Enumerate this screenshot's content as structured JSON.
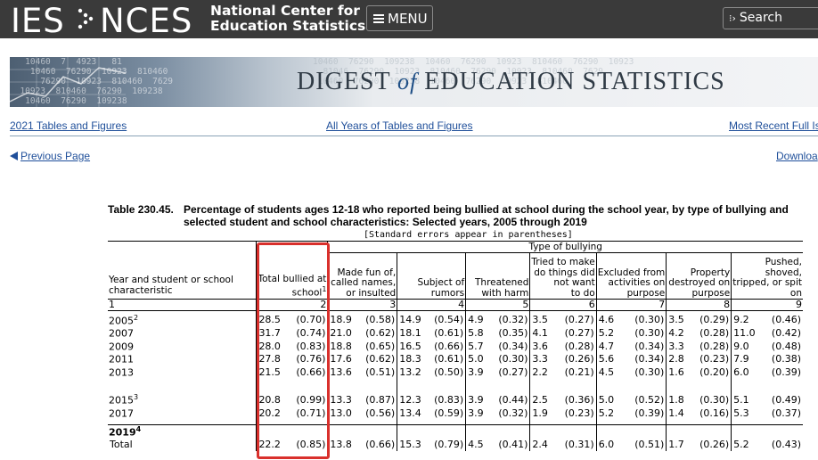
{
  "header": {
    "logo_ies": "IES",
    "logo_nces": "NCES",
    "org_line1": "National Center for",
    "org_line2": "Education Statistics",
    "menu_label": "MENU",
    "search_label": "Search"
  },
  "banner": {
    "title_part1": "DIGEST",
    "title_of": "of",
    "title_part2": "EDUCATION STATISTICS",
    "numbers_left": "   10460  7  4923   81\n    10460  76290  10923  810460\n      76290  10923  810460  7629\n  10923  810460  76290  109238\n   10460  76290  109238",
    "numbers_right": "10460  76290  109238  10460  76290  10923  810460  76290  10923\n  81046  76290  10923  810460  76290  10923  810460  7629\n 10460  76290  109238  10460  76290  10923  810460"
  },
  "nav": {
    "link_2021": "2021 Tables and Figures",
    "link_all_years": "All Years of Tables and Figures",
    "link_recent": "Most Recent Full Is",
    "previous_page": "Previous Page",
    "download": "Downloa"
  },
  "table": {
    "number": "Table 230.45.",
    "title": "Percentage of students ages 12-18 who reported being bullied at school during the school year, by type of bullying and selected student and school characteristics: Selected years, 2005 through 2019",
    "se_note": "[Standard errors appear in parentheses]",
    "type_header": "Type of bullying",
    "col0_line1": "Year and student or school",
    "col0_line2": "characteristic",
    "col1_line1": "Total bullied at",
    "col1_line2": "school",
    "col1_sup": "1",
    "col2_line1": "Made fun of,",
    "col2_line2": "called names,",
    "col2_line3": "or insulted",
    "col3_line1": "Subject of",
    "col3_line2": "rumors",
    "col4_line1": "Threatened",
    "col4_line2": "with harm",
    "col5_line1": "Tried to make",
    "col5_line2": "do things did",
    "col5_line3": "not want",
    "col5_line4": "to do",
    "col6_line1": "Excluded from",
    "col6_line2": "activities on",
    "col6_line3": "purpose",
    "col7_line1": "Property",
    "col7_line2": "destroyed on",
    "col7_line3": "purpose",
    "col8_line1": "Pushed,",
    "col8_line2": "shoved,",
    "col8_line3": "tripped, or spit",
    "col8_line4": "on",
    "colnums": [
      "1",
      "2",
      "3",
      "4",
      "5",
      "6",
      "7",
      "8",
      "9"
    ],
    "rows": [
      {
        "year": "2005",
        "sup": "2",
        "vals": [
          "28.5",
          "(0.70)",
          "18.9",
          "(0.58)",
          "14.9",
          "(0.54)",
          "4.9",
          "(0.32)",
          "3.5",
          "(0.27)",
          "4.6",
          "(0.30)",
          "3.5",
          "(0.29)",
          "9.2",
          "(0.46)"
        ]
      },
      {
        "year": "2007",
        "sup": "",
        "vals": [
          "31.7",
          "(0.74)",
          "21.0",
          "(0.62)",
          "18.1",
          "(0.61)",
          "5.8",
          "(0.35)",
          "4.1",
          "(0.27)",
          "5.2",
          "(0.30)",
          "4.2",
          "(0.28)",
          "11.0",
          "(0.42)"
        ]
      },
      {
        "year": "2009",
        "sup": "",
        "vals": [
          "28.0",
          "(0.83)",
          "18.8",
          "(0.65)",
          "16.5",
          "(0.66)",
          "5.7",
          "(0.34)",
          "3.6",
          "(0.28)",
          "4.7",
          "(0.34)",
          "3.3",
          "(0.28)",
          "9.0",
          "(0.48)"
        ]
      },
      {
        "year": "2011",
        "sup": "",
        "vals": [
          "27.8",
          "(0.76)",
          "17.6",
          "(0.62)",
          "18.3",
          "(0.61)",
          "5.0",
          "(0.30)",
          "3.3",
          "(0.26)",
          "5.6",
          "(0.34)",
          "2.8",
          "(0.23)",
          "7.9",
          "(0.38)"
        ]
      },
      {
        "year": "2013",
        "sup": "",
        "vals": [
          "21.5",
          "(0.66)",
          "13.6",
          "(0.51)",
          "13.2",
          "(0.50)",
          "3.9",
          "(0.27)",
          "2.2",
          "(0.21)",
          "4.5",
          "(0.30)",
          "1.6",
          "(0.20)",
          "6.0",
          "(0.39)"
        ]
      },
      {
        "year": "2015",
        "sup": "3",
        "vals": [
          "20.8",
          "(0.99)",
          "13.3",
          "(0.87)",
          "12.3",
          "(0.83)",
          "3.9",
          "(0.44)",
          "2.5",
          "(0.36)",
          "5.0",
          "(0.52)",
          "1.8",
          "(0.30)",
          "5.1",
          "(0.49)"
        ]
      },
      {
        "year": "2017",
        "sup": "",
        "vals": [
          "20.2",
          "(0.71)",
          "13.0",
          "(0.56)",
          "13.4",
          "(0.59)",
          "3.9",
          "(0.32)",
          "1.9",
          "(0.23)",
          "5.2",
          "(0.39)",
          "1.4",
          "(0.16)",
          "5.3",
          "(0.37)"
        ]
      }
    ],
    "total_year": "2019",
    "total_sup": "4",
    "total_label": "Total",
    "total_vals": [
      "22.2",
      "(0.85)",
      "13.8",
      "(0.66)",
      "15.3",
      "(0.79)",
      "4.5",
      "(0.41)",
      "2.4",
      "(0.31)",
      "6.0",
      "(0.51)",
      "1.7",
      "(0.26)",
      "5.2",
      "(0.43)"
    ]
  }
}
